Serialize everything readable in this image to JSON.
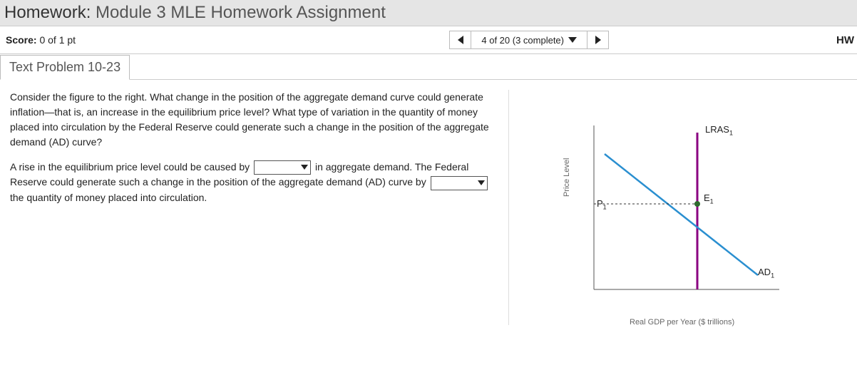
{
  "title": {
    "prefix": "Homework:",
    "name": "Module 3 MLE Homework Assignment"
  },
  "score": {
    "label": "Score:",
    "value": "0 of 1 pt"
  },
  "nav": {
    "position": "4 of 20 (3 complete)"
  },
  "right_badge": "HW",
  "problem_tab": "Text Problem 10-23",
  "question": {
    "para1": "Consider the figure to the right. What change in the position of the aggregate demand curve could generate inflation—that is, an increase in the equilibrium price level? What type of variation in the quantity of money placed into circulation by the Federal Reserve could generate such a change in the position of the aggregate demand (AD) curve?",
    "seg1": "A rise in the equilibrium price level could be caused by ",
    "seg2": " in aggregate demand. The Federal Reserve could generate such a change in the position of the aggregate demand (AD) curve by ",
    "seg3": " the quantity of money placed into circulation."
  },
  "chart_data": {
    "type": "line",
    "title": "",
    "xlabel": "Real GDP per Year ($ trillions)",
    "ylabel": "Price Level",
    "series": [
      {
        "name": "LRAS1",
        "kind": "vertical",
        "x": 60,
        "color": "#8a0080"
      },
      {
        "name": "AD1",
        "kind": "downward",
        "points": [
          [
            10,
            85
          ],
          [
            95,
            15
          ]
        ],
        "color": "#2a8fd0"
      }
    ],
    "equilibrium": {
      "label": "E1",
      "x": 60,
      "y": 44
    },
    "price_marker": {
      "label": "P1",
      "y": 44
    },
    "labels": {
      "lras": "LRAS",
      "lras_sub": "1",
      "ad": "AD",
      "ad_sub": "1",
      "e": "E",
      "e_sub": "1",
      "p": "P",
      "p_sub": "1"
    }
  }
}
